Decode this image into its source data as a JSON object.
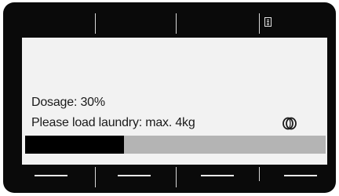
{
  "display": {
    "dosage_text": "Dosage: 30%",
    "load_text": "Please load laundry: max. 4kg",
    "progress": 0.33,
    "top_icon": "menu-list-icon",
    "status_icon": "detergent-icon"
  },
  "colors": {
    "bezel": "#0a0a0a",
    "screen": "#f2f2f2",
    "progress_track": "#b4b4b4",
    "progress_fill": "#000000"
  }
}
